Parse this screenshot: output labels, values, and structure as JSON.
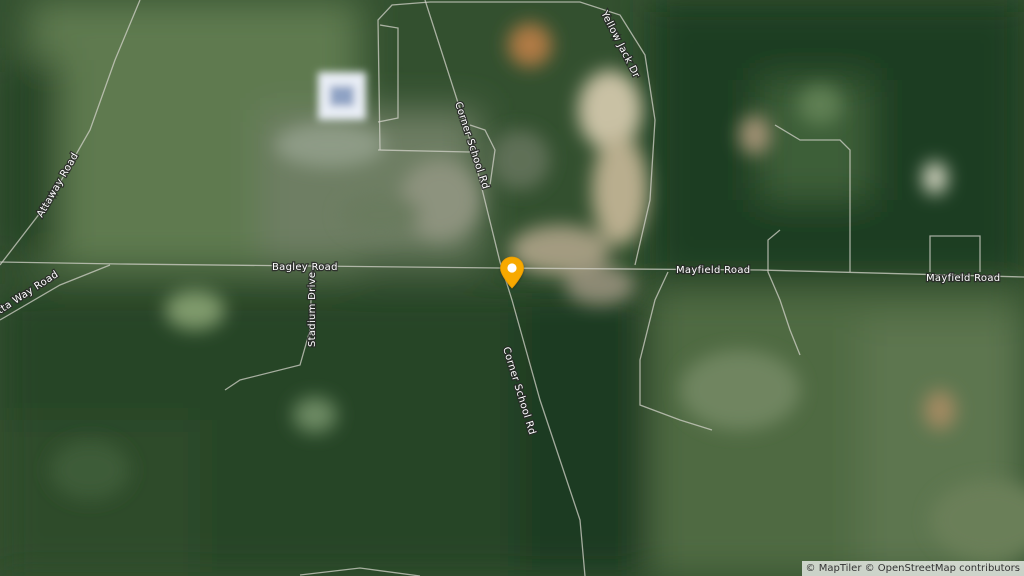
{
  "map": {
    "base_style": "satellite",
    "marker": {
      "icon": "map-pin-icon",
      "color": "#f7a900"
    },
    "roads": [
      {
        "id": "bagley-road",
        "label": "Bagley Road"
      },
      {
        "id": "mayfield-road-1",
        "label": "Mayfield Road"
      },
      {
        "id": "mayfield-road-2",
        "label": "Mayfield Road"
      },
      {
        "id": "corner-school-rd-north",
        "label": "Corner School Rd"
      },
      {
        "id": "corner-school-rd-south",
        "label": "Corner School Rd"
      },
      {
        "id": "yellow-jack-dr",
        "label": "Yellow Jack Dr"
      },
      {
        "id": "attaway-road",
        "label": "Attaway Road"
      },
      {
        "id": "etta-way-road",
        "label": "tta Way Road"
      },
      {
        "id": "stadium-drive",
        "label": "Stadium Drive"
      }
    ]
  },
  "attribution": {
    "text": "© MapTiler © OpenStreetMap contributors"
  }
}
